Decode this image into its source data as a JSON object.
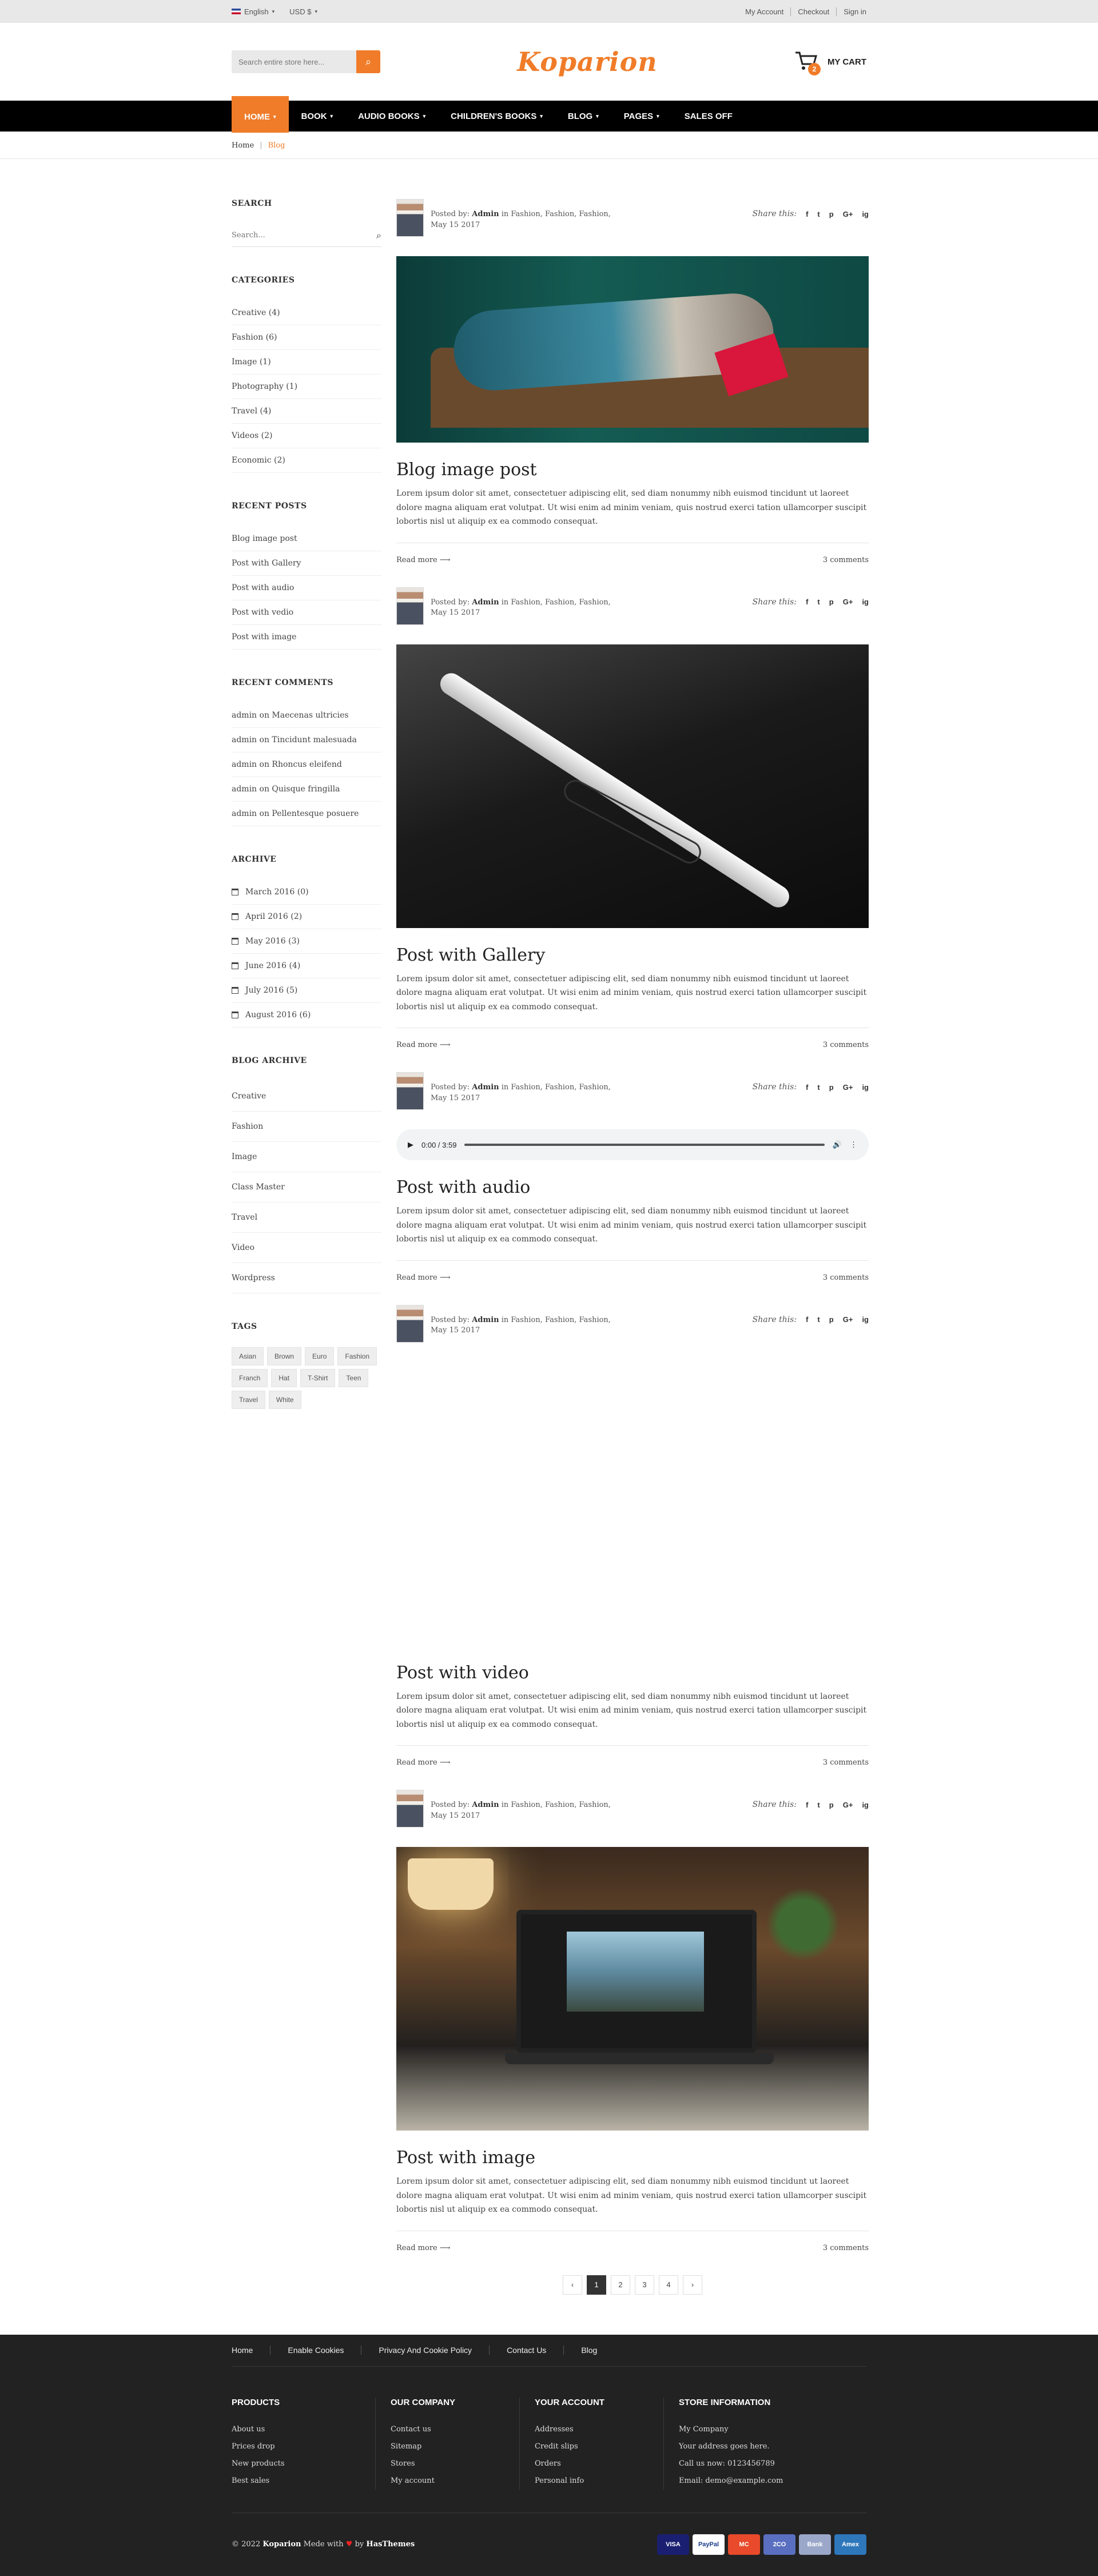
{
  "topbar": {
    "language": "English",
    "currency": "USD $",
    "links": [
      "My Account",
      "Checkout",
      "Sign in"
    ]
  },
  "header": {
    "search_placeholder": "Search entire store here...",
    "logo": "Koparion",
    "cart_label": "MY CART",
    "cart_count": "2"
  },
  "nav": [
    "HOME",
    "BOOK",
    "AUDIO BOOKS",
    "CHILDREN'S BOOKS",
    "BLOG",
    "PAGES",
    "SALES OFF"
  ],
  "breadcrumb": {
    "home": "Home",
    "sep": "|",
    "current": "Blog"
  },
  "sidebar": {
    "search_title": "SEARCH",
    "search_placeholder": "Search...",
    "categories_title": "CATEGORIES",
    "categories": [
      "Creative (4)",
      "Fashion (6)",
      "Image (1)",
      "Photography (1)",
      "Travel (4)",
      "Videos (2)",
      "Economic (2)"
    ],
    "recent_posts_title": "RECENT POSTS",
    "recent_posts": [
      "Blog image post",
      "Post with Gallery",
      "Post with audio",
      "Post with vedio",
      "Post with image"
    ],
    "recent_comments_title": "RECENT COMMENTS",
    "recent_comments": [
      "admin on Maecenas ultricies",
      "admin on Tincidunt malesuada",
      "admin on Rhoncus eleifend",
      "admin on Quisque fringilla",
      "admin on Pellentesque posuere"
    ],
    "archive_title": "ARCHIVE",
    "archive": [
      "March 2016 (0)",
      "April 2016 (2)",
      "May 2016 (3)",
      "June 2016 (4)",
      "July 2016 (5)",
      "August 2016 (6)"
    ],
    "blog_archive_title": "BLOG ARCHIVE",
    "blog_archive": [
      "Creative",
      "Fashion",
      "Image",
      "Class Master",
      "Travel",
      "Video",
      "Wordpress"
    ],
    "tags_title": "TAGS",
    "tags": [
      "Asian",
      "Brown",
      "Euro",
      "Fashion",
      "Franch",
      "Hat",
      "T-Shirt",
      "Teen",
      "Travel",
      "White"
    ]
  },
  "post_common": {
    "posted_by": "Posted by:",
    "author": "Admin",
    "categories_text": "in Fashion, Fashion, Fashion,",
    "date": "May 15 2017",
    "share_label": "Share this:",
    "share_icons": [
      "f",
      "t",
      "p",
      "G+",
      "ig"
    ],
    "excerpt": "Lorem ipsum dolor sit amet, consectetuer adipiscing elit, sed diam nonummy nibh euismod tincidunt ut laoreet dolore magna aliquam erat volutpat. Ut wisi enim ad minim veniam, quis nostrud exerci tation ullamcorper suscipit lobortis nisl ut aliquip ex ea commodo consequat.",
    "read_more": "Read more",
    "comments": "3 comments"
  },
  "posts": [
    {
      "title": "Blog image post"
    },
    {
      "title": "Post with Gallery"
    },
    {
      "title": "Post with audio",
      "audio_time": "0:00 / 3:59"
    },
    {
      "title": "Post with video"
    },
    {
      "title": "Post with image"
    }
  ],
  "pagination": [
    "‹",
    "1",
    "2",
    "3",
    "4",
    "›"
  ],
  "footer": {
    "links": [
      "Home",
      "Enable Cookies",
      "Privacy And Cookie Policy",
      "Contact Us",
      "Blog"
    ],
    "products_title": "PRODUCTS",
    "products": [
      "About us",
      "Prices drop",
      "New products",
      "Best sales"
    ],
    "company_title": "OUR COMPANY",
    "company": [
      "Contact us",
      "Sitemap",
      "Stores",
      "My account"
    ],
    "account_title": "YOUR ACCOUNT",
    "account": [
      "Addresses",
      "Credit slips",
      "Orders",
      "Personal info"
    ],
    "store_title": "STORE INFORMATION",
    "store": [
      "My Company",
      "Your address goes here.",
      "Call us now: 0123456789",
      "Email: demo@example.com"
    ],
    "copyright_prefix": "© 2022",
    "brand": "Koparion",
    "made_with": "Mede with",
    "by": "by",
    "author": "HasThemes",
    "payments": [
      "VISA",
      "PayPal",
      "MC",
      "2CO",
      "Bank",
      "Amex"
    ],
    "payment_colors": [
      "#1a1f71",
      "#ffffff",
      "#e84a2b",
      "#5a6fc0",
      "#9aa7c9",
      "#2e77bb"
    ]
  }
}
